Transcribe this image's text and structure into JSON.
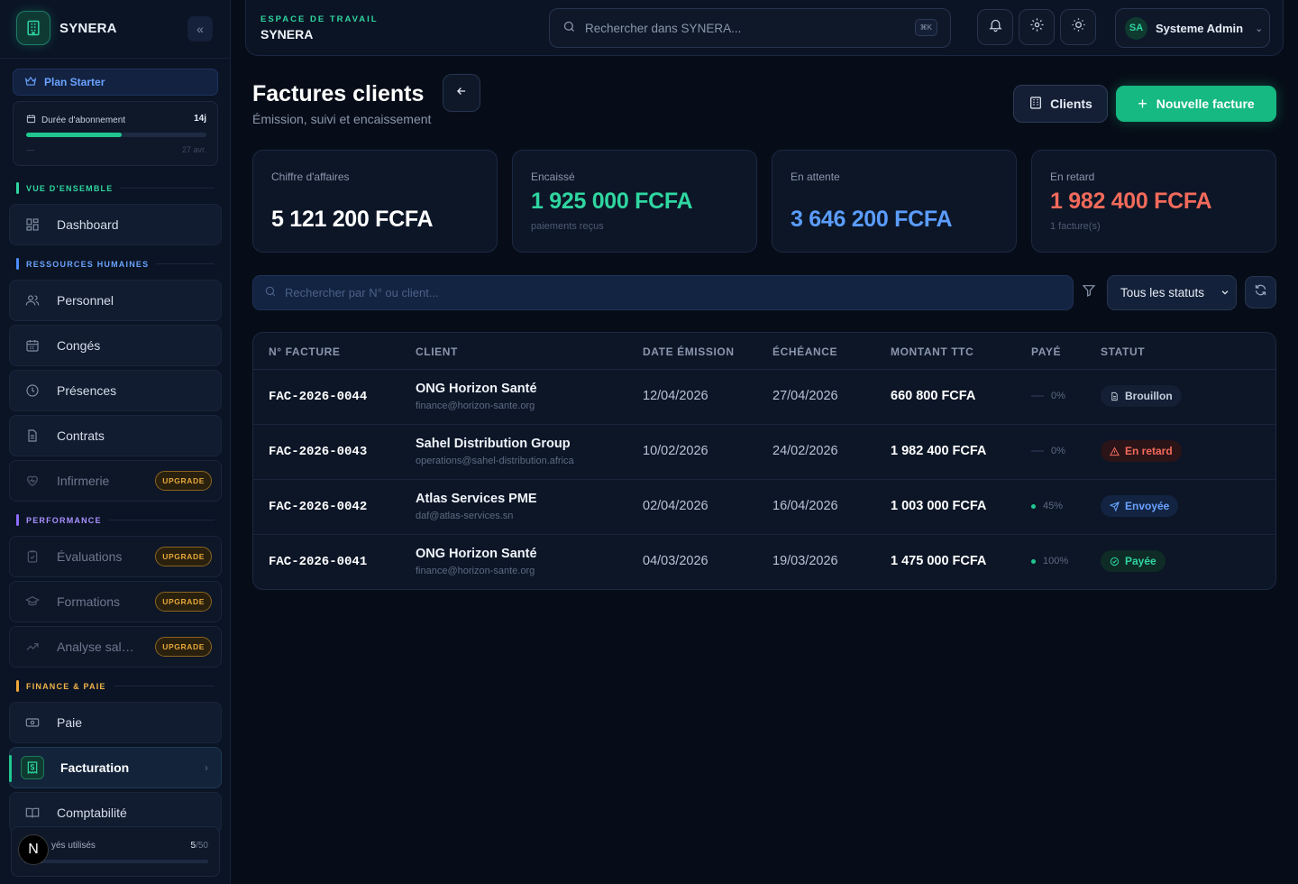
{
  "brand": {
    "name": "SYNERA"
  },
  "plan": {
    "label": "Plan Starter",
    "subscription_label": "Durée d'abonnement",
    "days_left": "14j",
    "progress": 0.53,
    "start": "—",
    "end": "27 avr."
  },
  "sections": {
    "overview": "VUE D'ENSEMBLE",
    "hr": "RESSOURCES HUMAINES",
    "performance": "PERFORMANCE",
    "finance": "FINANCE & PAIE"
  },
  "nav": {
    "dashboard": "Dashboard",
    "personnel": "Personnel",
    "conges": "Congés",
    "presences": "Présences",
    "contrats": "Contrats",
    "infirmerie": "Infirmerie",
    "evaluations": "Évaluations",
    "formations": "Formations",
    "analyse": "Analyse salari…",
    "paie": "Paie",
    "facturation": "Facturation",
    "comptabilite": "Comptabilité",
    "upgrade_label": "UPGRADE"
  },
  "usage": {
    "label": "yés utilisés",
    "used": "5",
    "total": "/50",
    "progress": 0.1
  },
  "n_badge": "N",
  "header": {
    "workspace_eyebrow": "ESPACE DE TRAVAIL",
    "workspace_name": "SYNERA",
    "search_placeholder": "Rechercher dans SYNERA...",
    "search_shortcut": "⌘K",
    "user_initials": "SA",
    "user_name": "Systeme Admin"
  },
  "page": {
    "title": "Factures clients",
    "subtitle": "Émission, suivi et encaissement",
    "clients_button": "Clients",
    "new_button": "Nouvelle facture"
  },
  "kpis": [
    {
      "label": "Chiffre d'affaires",
      "value": "5 121 200 FCFA",
      "sub": "",
      "color": "#ffffff"
    },
    {
      "label": "Encaissé",
      "value": "1 925 000 FCFA",
      "sub": "paiements reçus",
      "color": "#2fd6a0"
    },
    {
      "label": "En attente",
      "value": "3 646 200 FCFA",
      "sub": "",
      "color": "#5b9dff"
    },
    {
      "label": "En retard",
      "value": "1 982 400 FCFA",
      "sub": "1 facture(s)",
      "color": "#f26a5b"
    }
  ],
  "filters": {
    "search_placeholder": "Rechercher par N° ou client...",
    "status_selected": "Tous les statuts"
  },
  "table": {
    "headers": [
      "N° FACTURE",
      "CLIENT",
      "DATE ÉMISSION",
      "ÉCHÉANCE",
      "MONTANT TTC",
      "PAYÉ",
      "STATUT"
    ],
    "rows": [
      {
        "number": "FAC-2026-0044",
        "client": "ONG Horizon Santé",
        "email": "finance@horizon-sante.org",
        "issued": "12/04/2026",
        "due": "27/04/2026",
        "amount": "660 800 FCFA",
        "paid": "0%",
        "paid_fraction": 0,
        "status": "Brouillon",
        "status_kind": "draft"
      },
      {
        "number": "FAC-2026-0043",
        "client": "Sahel Distribution Group",
        "email": "operations@sahel-distribution.africa",
        "issued": "10/02/2026",
        "due": "24/02/2026",
        "amount": "1 982 400 FCFA",
        "paid": "0%",
        "paid_fraction": 0,
        "status": "En retard",
        "status_kind": "late"
      },
      {
        "number": "FAC-2026-0042",
        "client": "Atlas Services PME",
        "email": "daf@atlas-services.sn",
        "issued": "02/04/2026",
        "due": "16/04/2026",
        "amount": "1 003 000 FCFA",
        "paid": "45%",
        "paid_fraction": 0.45,
        "status": "Envoyée",
        "status_kind": "sent"
      },
      {
        "number": "FAC-2026-0041",
        "client": "ONG Horizon Santé",
        "email": "finance@horizon-sante.org",
        "issued": "04/03/2026",
        "due": "19/03/2026",
        "amount": "1 475 000 FCFA",
        "paid": "100%",
        "paid_fraction": 1,
        "status": "Payée",
        "status_kind": "paid"
      }
    ]
  },
  "colors": {
    "accent": "#16b981",
    "primary_blue": "#5b9dff",
    "danger": "#f26a5b"
  }
}
